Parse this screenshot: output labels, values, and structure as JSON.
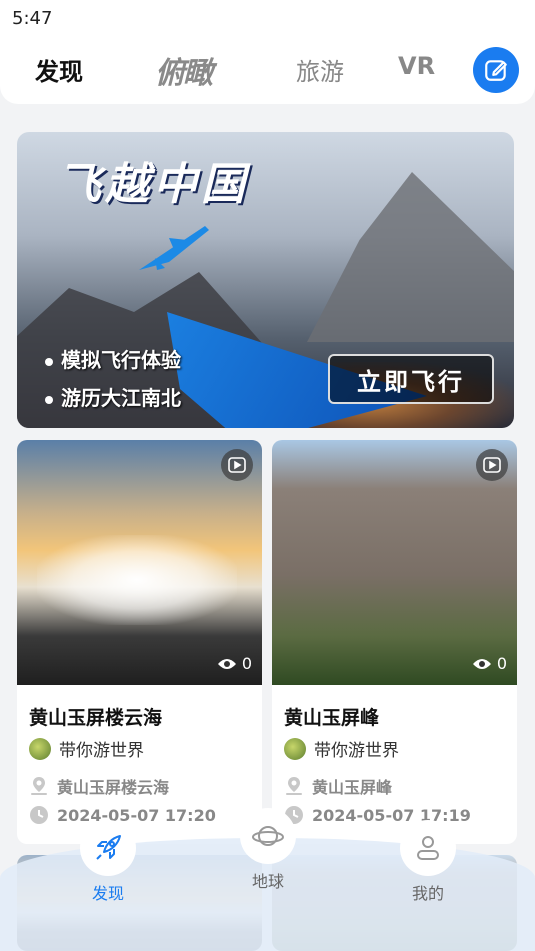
{
  "status_bar": {
    "time": "5:47"
  },
  "top_nav": {
    "tabs": [
      {
        "label": "发现",
        "active": true
      },
      {
        "label": "俯瞰",
        "active": false
      },
      {
        "label": "旅游",
        "active": false
      },
      {
        "label": "VR",
        "active": false
      }
    ],
    "edit_icon": "edit-icon"
  },
  "banner": {
    "title": "飞越中国",
    "features": [
      "模拟飞行体验",
      "游历大江南北"
    ],
    "cta": "立即飞行"
  },
  "cards": [
    {
      "title": "黄山玉屏楼云海",
      "author": "带你游世界",
      "location": "黄山玉屏楼云海",
      "time": "2024-05-07 17:20",
      "views": "0"
    },
    {
      "title": "黄山玉屏峰",
      "author": "带你游世界",
      "location": "黄山玉屏峰",
      "time": "2024-05-07 17:19",
      "views": "0"
    }
  ],
  "tab_bar": {
    "items": [
      {
        "label": "发现",
        "icon": "rocket-icon",
        "active": true
      },
      {
        "label": "地球",
        "icon": "planet-icon",
        "active": false
      },
      {
        "label": "我的",
        "icon": "user-icon",
        "active": false
      }
    ]
  },
  "colors": {
    "accent": "#1a7cf0",
    "background": "#f2f3f5"
  }
}
